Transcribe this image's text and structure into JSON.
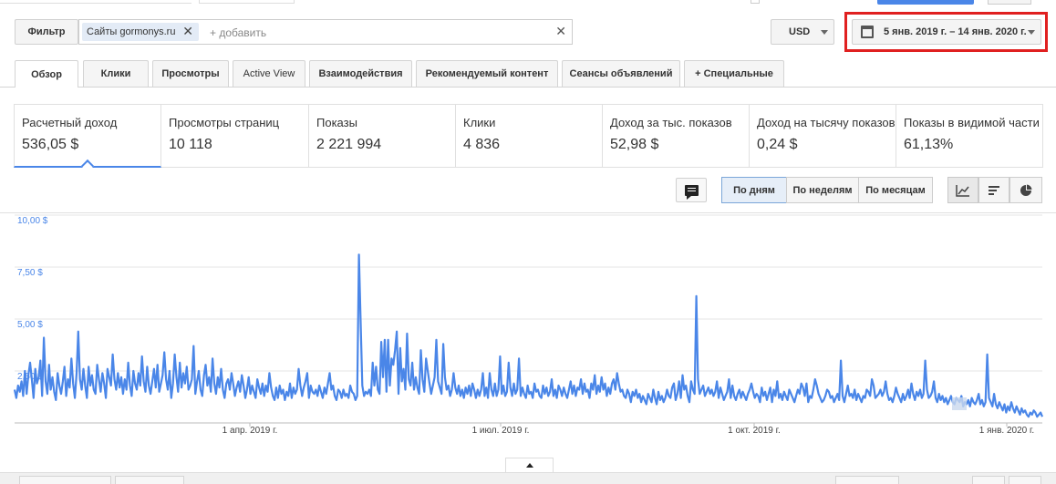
{
  "filter": {
    "filter_label": "Фильтр",
    "chip_label": "Сайты gormonys.ru",
    "add_placeholder": "+ добавить"
  },
  "currency": "USD",
  "date_range": "5 янв. 2019 г. – 14 янв. 2020 г.",
  "tabs": [
    {
      "label": "Обзор"
    },
    {
      "label": "Клики"
    },
    {
      "label": "Просмотры"
    },
    {
      "label": "Active View"
    },
    {
      "label": "Взаимодействия"
    },
    {
      "label": "Рекомендуемый контент"
    },
    {
      "label": "Сеансы объявлений"
    },
    {
      "label": "+ Специальные"
    }
  ],
  "metrics": [
    {
      "label": "Расчетный доход",
      "value": "536,05 $"
    },
    {
      "label": "Просмотры страниц",
      "value": "10 118"
    },
    {
      "label": "Показы",
      "value": "2 221 994"
    },
    {
      "label": "Клики",
      "value": "4 836"
    },
    {
      "label": "Доход за тыс. показов",
      "value": "52,98 $"
    },
    {
      "label": "Доход на тысячу показов",
      "value": "0,24 $"
    },
    {
      "label": "Показы в видимой части",
      "value": "61,13%"
    }
  ],
  "granularity": {
    "by_day": "По дням",
    "by_week": "По неделям",
    "by_month": "По месяцам"
  },
  "colors": {
    "accent": "#4a86e8",
    "highlight_border": "#e02020"
  },
  "chart_data": {
    "type": "line",
    "y_ticks": [
      "10,00 $",
      "7,50 $",
      "5,00 $",
      "2,50 $"
    ],
    "ylim": [
      0,
      10
    ],
    "x_ticks": [
      "1 апр. 2019 г.",
      "1 июл. 2019 г.",
      "1 окт. 2019 г.",
      "1 янв. 2020 г."
    ],
    "grid": true,
    "series": [
      {
        "values": [
          1.6,
          1.2,
          1.8,
          1.5,
          2.0,
          1.3,
          2.5,
          1.4,
          2.3,
          2.9,
          2.1,
          1.2,
          2.6,
          1.9,
          2.2,
          3.0,
          1.3,
          4.1,
          2.0,
          1.4,
          2.8,
          1.6,
          2.2,
          1.5,
          1.1,
          2.4,
          1.8,
          1.4,
          2.0,
          2.7,
          1.3,
          2.1,
          1.7,
          3.1,
          1.9,
          1.2,
          2.4,
          4.4,
          2.1,
          1.6,
          2.6,
          1.8,
          1.2,
          2.7,
          1.8,
          2.3,
          1.6,
          1.4,
          2.8,
          2.1,
          1.5,
          2.4,
          1.9,
          1.2,
          2.6,
          2.2,
          1.8,
          3.3,
          2.1,
          1.6,
          2.4,
          1.7,
          2.2,
          1.4,
          2.1,
          1.6,
          2.9,
          1.8,
          1.3,
          2.5,
          1.9,
          1.6,
          2.4,
          1.8,
          3.2,
          2.0,
          1.5,
          2.7,
          1.8,
          1.4,
          2.0,
          2.6,
          1.7,
          2.8,
          1.5,
          1.9,
          2.3,
          3.4,
          2.1,
          1.6,
          2.5,
          1.2,
          1.9,
          3.3,
          2.2,
          1.5,
          2.9,
          1.7,
          2.4,
          1.9,
          2.7,
          1.6,
          1.8,
          2.1,
          3.7,
          1.4,
          2.0,
          2.5,
          1.6,
          1.3,
          2.3,
          2.8,
          1.8,
          2.2,
          1.5,
          3.1,
          1.9,
          1.4,
          2.2,
          1.7,
          2.6,
          1.6,
          1.2,
          1.9,
          2.1,
          1.6,
          2.4,
          1.9,
          1.3,
          1.7,
          2.0,
          1.5,
          2.3,
          1.8,
          1.2,
          1.6,
          2.2,
          1.4,
          1.8,
          1.5,
          1.2,
          2.1,
          1.7,
          1.4,
          1.9,
          1.3,
          1.8,
          1.5,
          2.4,
          1.7,
          1.3,
          1.1,
          1.7,
          1.2,
          1.8,
          1.4,
          1.6,
          1.1,
          1.5,
          1.3,
          1.9,
          1.2,
          1.7,
          1.4,
          1.6,
          2.6,
          1.8,
          1.3,
          1.7,
          2.0,
          2.4,
          1.2,
          1.8,
          1.5,
          1.4,
          1.6,
          1.3,
          1.8,
          1.5,
          1.2,
          1.7,
          1.4,
          1.9,
          2.4,
          1.6,
          1.8,
          1.3,
          1.1,
          1.6,
          1.5,
          1.2,
          1.6,
          1.3,
          1.4,
          1.2,
          1.8,
          1.5,
          1.4,
          1.1,
          1.3,
          8.1,
          5.0,
          1.8,
          1.3,
          1.5,
          1.4,
          1.6,
          1.3,
          2.9,
          1.8,
          2.7,
          1.6,
          1.4,
          3.9,
          2.2,
          4.0,
          1.5,
          4.0,
          1.8,
          3.1,
          2.8,
          3.5,
          4.4,
          1.4,
          3.6,
          2.0,
          2.6,
          1.6,
          4.3,
          2.1,
          1.8,
          2.9,
          1.6,
          2.2,
          1.7,
          1.4,
          3.5,
          2.1,
          1.5,
          3.1,
          2.5,
          1.9,
          1.4,
          1.8,
          2.2,
          4.0,
          2.0,
          1.7,
          1.4,
          3.8,
          2.2,
          1.6,
          1.8,
          1.3,
          1.6,
          2.4,
          1.7,
          1.4,
          1.8,
          1.3,
          1.6,
          1.2,
          1.7,
          1.4,
          1.8,
          1.3,
          1.9,
          1.6,
          1.2,
          1.6,
          1.3,
          1.6,
          2.4,
          1.3,
          1.7,
          1.2,
          2.4,
          1.6,
          1.3,
          1.9,
          1.3,
          1.6,
          3.2,
          1.4,
          1.8,
          1.3,
          1.5,
          2.9,
          1.7,
          1.3,
          1.9,
          1.4,
          1.6,
          3.1,
          1.3,
          1.7,
          1.4,
          1.2,
          1.8,
          1.4,
          1.5,
          1.2,
          1.9,
          1.5,
          1.6,
          1.3,
          1.2,
          1.8,
          1.4,
          1.7,
          1.3,
          1.5,
          2.1,
          1.3,
          1.6,
          1.2,
          1.8,
          1.6,
          1.3,
          1.7,
          1.4,
          1.2,
          1.6,
          2.0,
          1.4,
          1.8,
          1.3,
          1.7,
          1.6,
          2.1,
          1.4,
          1.9,
          1.5,
          1.6,
          1.2,
          1.9,
          1.6,
          2.3,
          1.4,
          1.8,
          1.5,
          2.2,
          1.6,
          1.9,
          1.3,
          1.7,
          1.4,
          1.9,
          2.1,
          1.6,
          2.4,
          1.9,
          1.5,
          1.6,
          1.3,
          1.2,
          1.6,
          1.4,
          1.0,
          1.5,
          1.3,
          1.6,
          1.2,
          1.4,
          1.0,
          1.3,
          1.1,
          0.9,
          1.4,
          1.2,
          1.0,
          1.6,
          1.2,
          0.9,
          1.5,
          1.1,
          1.3,
          1.0,
          1.2,
          1.6,
          1.3,
          1.2,
          1.7,
          1.9,
          1.1,
          1.4,
          2.0,
          1.2,
          2.3,
          1.6,
          1.8,
          1.3,
          1.0,
          2.0,
          1.6,
          1.4,
          6.1,
          2.1,
          1.4,
          1.6,
          1.8,
          1.3,
          1.5,
          1.7,
          1.4,
          1.6,
          1.3,
          1.5,
          2.0,
          1.2,
          1.7,
          1.4,
          1.1,
          1.3,
          1.5,
          2.1,
          1.2,
          1.8,
          1.3,
          1.1,
          1.4,
          1.6,
          1.2,
          1.5,
          1.3,
          1.1,
          1.4,
          1.6,
          1.9,
          1.5,
          1.2,
          1.4,
          1.3,
          1.0,
          1.7,
          1.3,
          1.5,
          1.1,
          1.4,
          1.7,
          1.0,
          1.6,
          1.3,
          2.0,
          1.2,
          1.4,
          1.1,
          1.5,
          1.3,
          1.1,
          1.6,
          1.4,
          1.2,
          1.0,
          1.3,
          1.6,
          1.4,
          1.9,
          1.7,
          1.3,
          1.9,
          1.0,
          1.3,
          1.2,
          1.6,
          2.1,
          1.8,
          1.4,
          1.2,
          1.0,
          1.1,
          1.3,
          1.6,
          1.5,
          1.2,
          1.3,
          1.0,
          1.2,
          1.4,
          1.1,
          3.0,
          1.3,
          1.0,
          1.4,
          1.8,
          1.3,
          1.4,
          1.2,
          1.6,
          1.1,
          1.4,
          1.2,
          1.0,
          1.3,
          1.2,
          1.6,
          1.5,
          1.3,
          2.1,
          1.8,
          1.2,
          1.3,
          1.4,
          1.6,
          1.3,
          1.5,
          2.0,
          1.4,
          1.1,
          1.2,
          1.0,
          1.3,
          1.7,
          1.4,
          1.2,
          1.0,
          1.4,
          1.1,
          1.3,
          1.6,
          1.2,
          1.9,
          1.4,
          1.1,
          1.5,
          1.3,
          1.6,
          1.2,
          1.4,
          3.0,
          1.6,
          1.2,
          1.3,
          1.5,
          2.0,
          1.2,
          1.0,
          1.4,
          1.1,
          1.3,
          1.0,
          1.2,
          0.9,
          1.1,
          1.3,
          1.0,
          0.9,
          1.2,
          1.1,
          1.0,
          1.3,
          0.8,
          1.0,
          0.9,
          1.1,
          0.8,
          1.2,
          1.0,
          0.9,
          1.1,
          1.4,
          0.9,
          1.1,
          0.8,
          1.0,
          3.3,
          1.2,
          1.0,
          0.8,
          1.4,
          0.9,
          0.7,
          1.0,
          0.8,
          0.6,
          0.9,
          0.5,
          0.8,
          0.6,
          1.0,
          0.7,
          0.5,
          0.8,
          0.6,
          0.4,
          0.7,
          0.5,
          0.6,
          0.4,
          0.3,
          0.5,
          0.4,
          0.6,
          0.5,
          0.3,
          0.4,
          0.5,
          0.3
        ]
      }
    ]
  }
}
